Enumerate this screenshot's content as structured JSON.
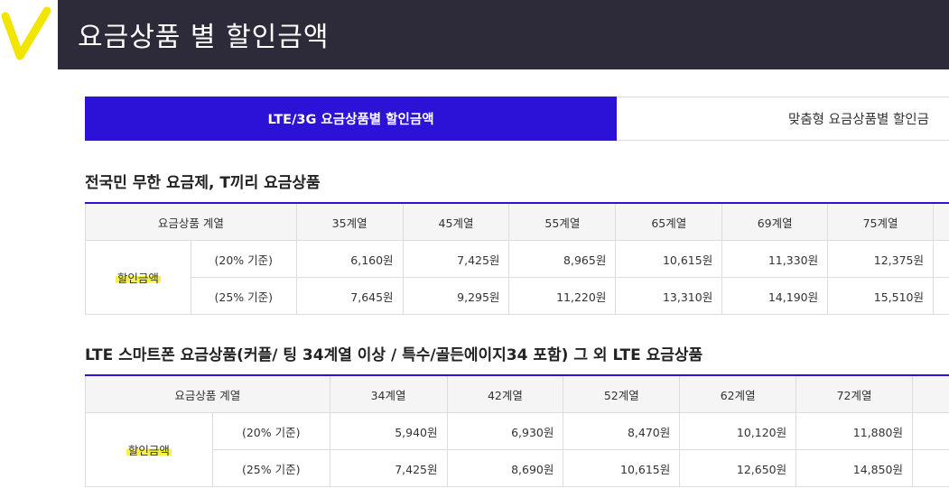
{
  "header": {
    "title": "요금상품 별 할인금액"
  },
  "colors": {
    "header_bg": "#2d2b3a",
    "accent": "#2b12d6",
    "logo": "#f2e600",
    "highlight": "#f5f04a"
  },
  "tabs": [
    {
      "label": "LTE/3G 요금상품별 할인금액",
      "active": true
    },
    {
      "label": "맞춤형 요금상품별 할인금",
      "active": false
    }
  ],
  "section1": {
    "title": "전국민 무한 요금제, T끼리 요금상품",
    "header_label": "요금상품 계열",
    "columns": [
      "35계열",
      "45계열",
      "55계열",
      "65계열",
      "69계열",
      "75계열"
    ],
    "row_label": "할인금액",
    "rows": [
      {
        "basis": "(20% 기준)",
        "values": [
          "6,160원",
          "7,425원",
          "8,965원",
          "10,615원",
          "11,330원",
          "12,375원"
        ]
      },
      {
        "basis": "(25% 기준)",
        "values": [
          "7,645원",
          "9,295원",
          "11,220원",
          "13,310원",
          "14,190원",
          "15,510원"
        ]
      }
    ]
  },
  "section2": {
    "title": "LTE 스마트폰 요금상품(커플/ 팅 34계열 이상 / 특수/골든에이지34 포함) 그 외 LTE 요금상품",
    "header_label": "요금상품 계열",
    "columns": [
      "34계열",
      "42계열",
      "52계열",
      "62계열",
      "72계열"
    ],
    "row_label": "할인금액",
    "rows": [
      {
        "basis": "(20% 기준)",
        "values": [
          "5,940원",
          "6,930원",
          "8,470원",
          "10,120원",
          "11,880원"
        ]
      },
      {
        "basis": "(25% 기준)",
        "values": [
          "7,425원",
          "8,690원",
          "10,615원",
          "12,650원",
          "14,850원"
        ]
      }
    ]
  }
}
